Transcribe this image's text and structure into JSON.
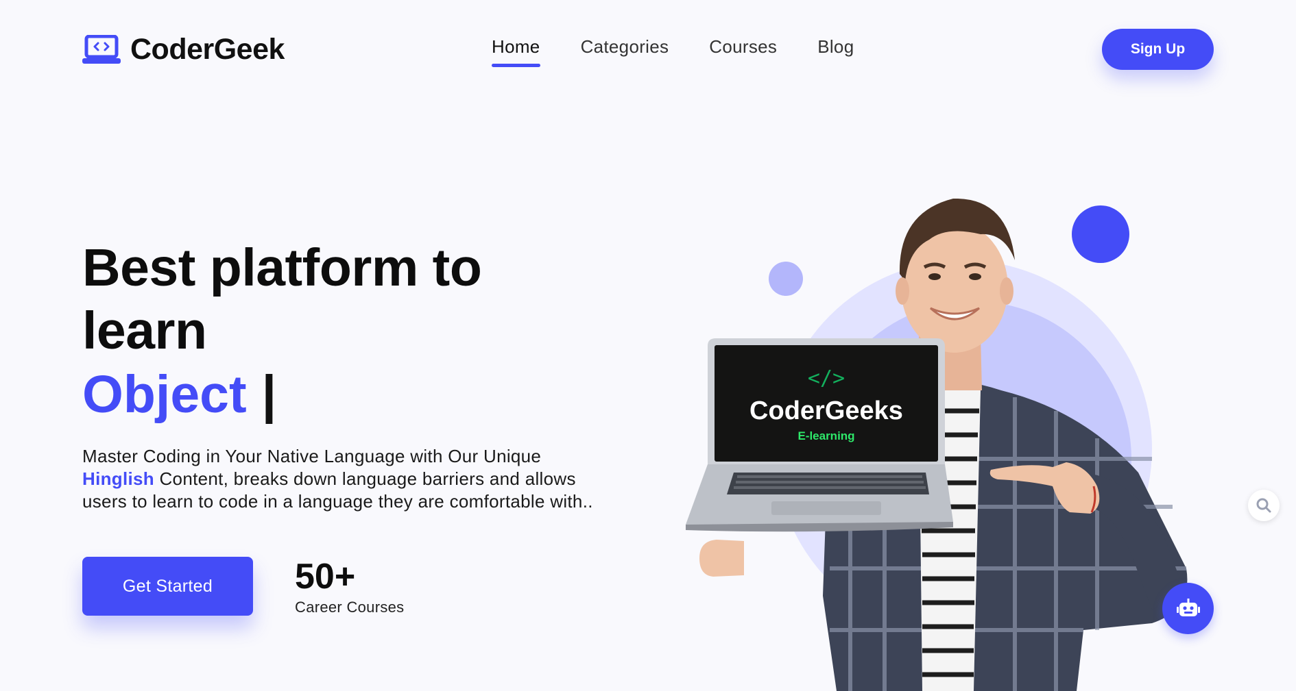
{
  "brand": {
    "name": "CoderGeek",
    "logo_icon": "laptop-code-icon",
    "accent_color": "#444cf7"
  },
  "nav": {
    "items": [
      {
        "label": "Home",
        "active": true
      },
      {
        "label": "Categories",
        "active": false
      },
      {
        "label": "Courses",
        "active": false
      },
      {
        "label": "Blog",
        "active": false
      }
    ],
    "signup_label": "Sign Up"
  },
  "hero": {
    "title": "Best platform to learn",
    "typed_word": "Object",
    "typed_cursor": "|",
    "description_before": "Master Coding in Your Native Language with Our Unique ",
    "description_highlight": "Hinglish",
    "description_after": " Content, breaks down language barriers and allows users to learn to code in a language they are comfortable with..",
    "cta_label": "Get Started",
    "stat_value": "50+",
    "stat_label": "Career Courses"
  },
  "laptop_screen": {
    "code_symbol": "</>",
    "brand": "CoderGeeks",
    "tagline": "E-learning"
  },
  "floating": {
    "side_widget_icon": "search-icon",
    "chat_icon": "robot-icon"
  }
}
